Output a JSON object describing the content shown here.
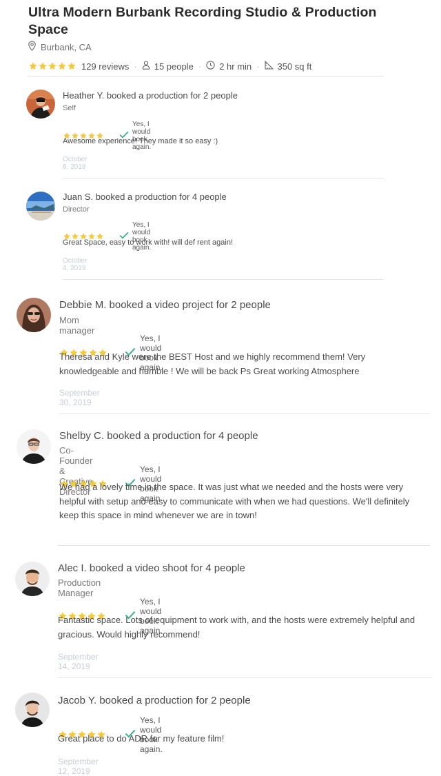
{
  "listing": {
    "title": "Ultra Modern Burbank Recording Studio & Production Space",
    "location": "Burbank, CA",
    "rating_stars": 5,
    "reviews_count": "129 reviews",
    "capacity": "15 people",
    "min_hours": "2 hr min",
    "size": "350 sq ft"
  },
  "colors": {
    "star": "#f5c842",
    "check": "#3bb08f",
    "date": "#c8cdd6"
  },
  "reviews": [
    {
      "heading": "Heather Y. booked a production for 2 people",
      "role": "Self",
      "stars": 5,
      "book_again": "Yes, I would book again.",
      "text": "Awesome experience! They made it so easy :)",
      "date": "October 6, 2019"
    },
    {
      "heading": "Juan S. booked a production for 4 people",
      "role": "Director",
      "stars": 5,
      "book_again": "Yes, I would book again.",
      "text": "Great Space, easy to work with! will def rent again!",
      "date": "October 4, 2019"
    },
    {
      "heading": "Debbie M. booked a video project for 2 people",
      "role": "Mom manager",
      "stars": 5,
      "book_again": "Yes, I would book again.",
      "text": "Theresa and Kyle were the BEST Host and we highly recommend them! Very knowledgeable and humble ! We will be back Ps Great working Atmosphere",
      "date": "September 30, 2019"
    },
    {
      "heading": "Shelby C. booked a production for 4 people",
      "role": "Co-Founder & Creative Director",
      "stars": 5,
      "book_again": "Yes, I would book again.",
      "text": "We had a lovely time in the space. It was just what we needed and the hosts were very helpful with setup and easy to communicate with when we had questions. We'll definitely keep this space in mind whenever we are in town!",
      "date": ""
    },
    {
      "heading": "Alec I. booked a video shoot for 4 people",
      "role": "Production Manager",
      "stars": 5,
      "book_again": "Yes, I would book again.",
      "text": "Fantastic space. Lots of equipment to work with, and the hosts were extremely helpful and gracious. Would highly recommend!",
      "date": "September 14, 2019"
    },
    {
      "heading": "Jacob Y. booked a production for 2 people",
      "role": "",
      "stars": 5,
      "book_again": "Yes, I would book again.",
      "text": "Great place to do ADR for my feature film!",
      "date": "September 12, 2019"
    }
  ]
}
